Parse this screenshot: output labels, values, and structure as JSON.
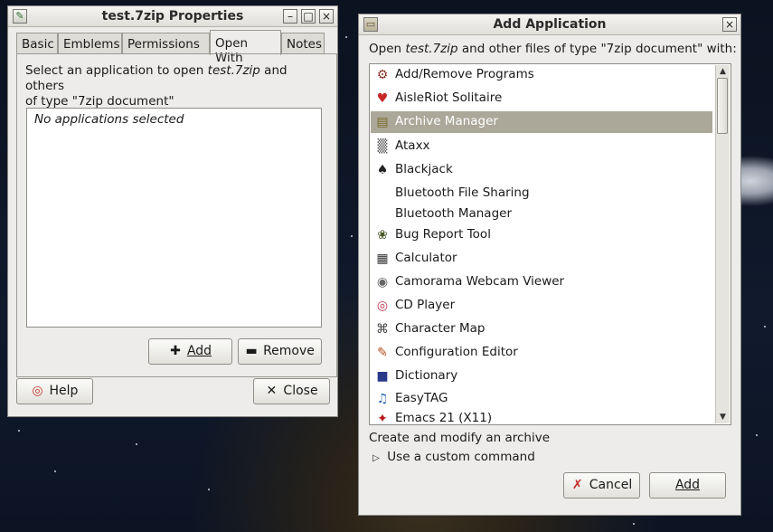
{
  "properties_window": {
    "title": "test.7zip Properties",
    "tabs": [
      "Basic",
      "Emblems",
      "Permissions",
      "Open With",
      "Notes"
    ],
    "active_tab": "Open With",
    "description_prefix": "Select an application to open",
    "description_file": "test.7zip",
    "description_rest": "and others",
    "description_line2": "of type \"7zip document\"",
    "empty_list_text": "No applications selected",
    "add_label": "Add",
    "remove_label": "Remove",
    "help_label": "Help",
    "close_label": "Close"
  },
  "add_app_window": {
    "title": "Add Application",
    "prompt_prefix": "Open",
    "prompt_file": "test.7zip",
    "prompt_rest": "and other files of type \"7zip document\" with:",
    "apps": [
      {
        "label": "Add/Remove Programs",
        "icon": "package-icon",
        "glyph": "⚙",
        "color": "#8a3a2a"
      },
      {
        "label": "AisleRiot Solitaire",
        "icon": "cards-icon",
        "glyph": "♥",
        "color": "#c62828"
      },
      {
        "label": "Archive Manager",
        "icon": "archive-icon",
        "glyph": "▤",
        "color": "#7a6a2a"
      },
      {
        "label": "Ataxx",
        "icon": "ataxx-grid-icon",
        "glyph": "▒",
        "color": "#555555"
      },
      {
        "label": "Blackjack",
        "icon": "blackjack-cards-icon",
        "glyph": "♠",
        "color": "#222222"
      },
      {
        "label": "Bluetooth File Sharing",
        "icon": "",
        "glyph": "",
        "color": "#000000"
      },
      {
        "label": "Bluetooth Manager",
        "icon": "",
        "glyph": "",
        "color": "#000000"
      },
      {
        "label": "Bug Report Tool",
        "icon": "bug-icon",
        "glyph": "❀",
        "color": "#4a5a2a"
      },
      {
        "label": "Calculator",
        "icon": "calculator-icon",
        "glyph": "▦",
        "color": "#333333"
      },
      {
        "label": "Camorama Webcam Viewer",
        "icon": "webcam-icon",
        "glyph": "◉",
        "color": "#666666"
      },
      {
        "label": "CD Player",
        "icon": "cd-icon",
        "glyph": "◎",
        "color": "#c0304a"
      },
      {
        "label": "Character Map",
        "icon": "character-map-icon",
        "glyph": "⌘",
        "color": "#444444"
      },
      {
        "label": "Configuration Editor",
        "icon": "config-editor-icon",
        "glyph": "✎",
        "color": "#b44a1a"
      },
      {
        "label": "Dictionary",
        "icon": "dictionary-icon",
        "glyph": "■",
        "color": "#2a3a8a"
      },
      {
        "label": "EasyTAG",
        "icon": "easytag-icon",
        "glyph": "♫",
        "color": "#2a6ab4"
      },
      {
        "label": "Emacs 21 (X11)",
        "icon": "emacs-icon",
        "glyph": "✦",
        "color": "#b41a1a"
      }
    ],
    "selected_app": "Archive Manager",
    "selected_description": "Create and modify an archive",
    "custom_command_label": "Use a custom command",
    "cancel_label": "Cancel",
    "add_label": "Add"
  },
  "colors": {
    "selection": "#aca899",
    "window_bg": "#edeceb"
  }
}
